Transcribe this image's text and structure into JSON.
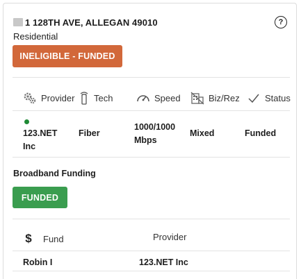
{
  "location": {
    "address": "1 128TH AVE, ALLEGAN 49010",
    "type": "Residential",
    "status_button": "INELIGIBLE - FUNDED",
    "help_icon": "question-circle-icon"
  },
  "service_table": {
    "headers": [
      {
        "label": "Provider",
        "icon": "gears-icon"
      },
      {
        "label": "Tech",
        "icon": "tower-antenna-icon"
      },
      {
        "label": "Speed",
        "icon": "speedometer-icon"
      },
      {
        "label": "Biz/Rez",
        "icon": "building-icon"
      },
      {
        "label": "Status",
        "icon": "checkmark-icon"
      }
    ],
    "rows": [
      {
        "provider": "123.NET Inc",
        "tech": "Fiber",
        "speed": "1000/1000 Mbps",
        "biz_rez": "Mixed",
        "status": "Funded",
        "indicator_color": "#1f8a35"
      }
    ]
  },
  "funding": {
    "title": "Broadband Funding",
    "status_button": "FUNDED",
    "headers": [
      {
        "label": "Fund",
        "icon": "dollar-icon"
      },
      {
        "label": "Provider",
        "icon": "gears-icon"
      }
    ],
    "rows": [
      {
        "fund": "Robin I",
        "provider": "123.NET Inc"
      }
    ]
  },
  "colors": {
    "ineligible": "#d2683a",
    "funded": "#3a9d4f"
  }
}
